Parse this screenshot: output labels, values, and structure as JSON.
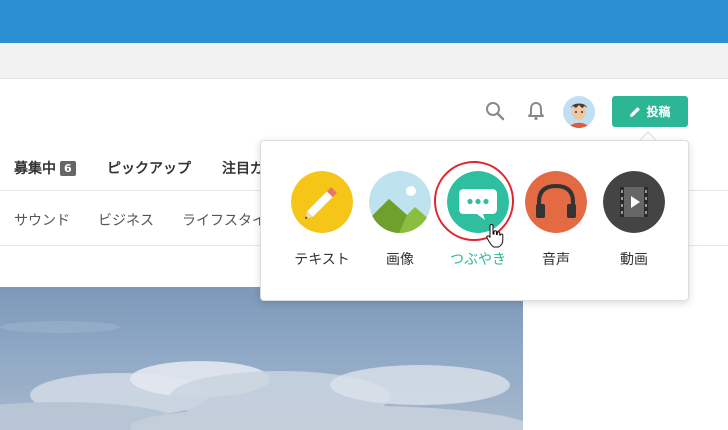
{
  "header": {
    "post_label": "投稿"
  },
  "tabs": [
    {
      "label": "募集中",
      "badge": "6"
    },
    {
      "label": "ピックアップ"
    },
    {
      "label": "注目ガ"
    }
  ],
  "categories": [
    "サウンド",
    "ビジネス",
    "ライフスタイ"
  ],
  "post_menu": {
    "items": [
      {
        "label": "テキスト",
        "icon": "pencil-icon",
        "color": "#f5c518"
      },
      {
        "label": "画像",
        "icon": "image-icon",
        "color": "#bfe3ee"
      },
      {
        "label": "つぶやき",
        "icon": "speech-bubble-icon",
        "color": "#2dbfa0",
        "active": true
      },
      {
        "label": "音声",
        "icon": "headphones-icon",
        "color": "#e36a43"
      },
      {
        "label": "動画",
        "icon": "film-icon",
        "color": "#444444"
      }
    ]
  },
  "colors": {
    "topbar": "#2b8fd3",
    "accent": "#2cb696",
    "highlight_ring": "#e0252c"
  }
}
